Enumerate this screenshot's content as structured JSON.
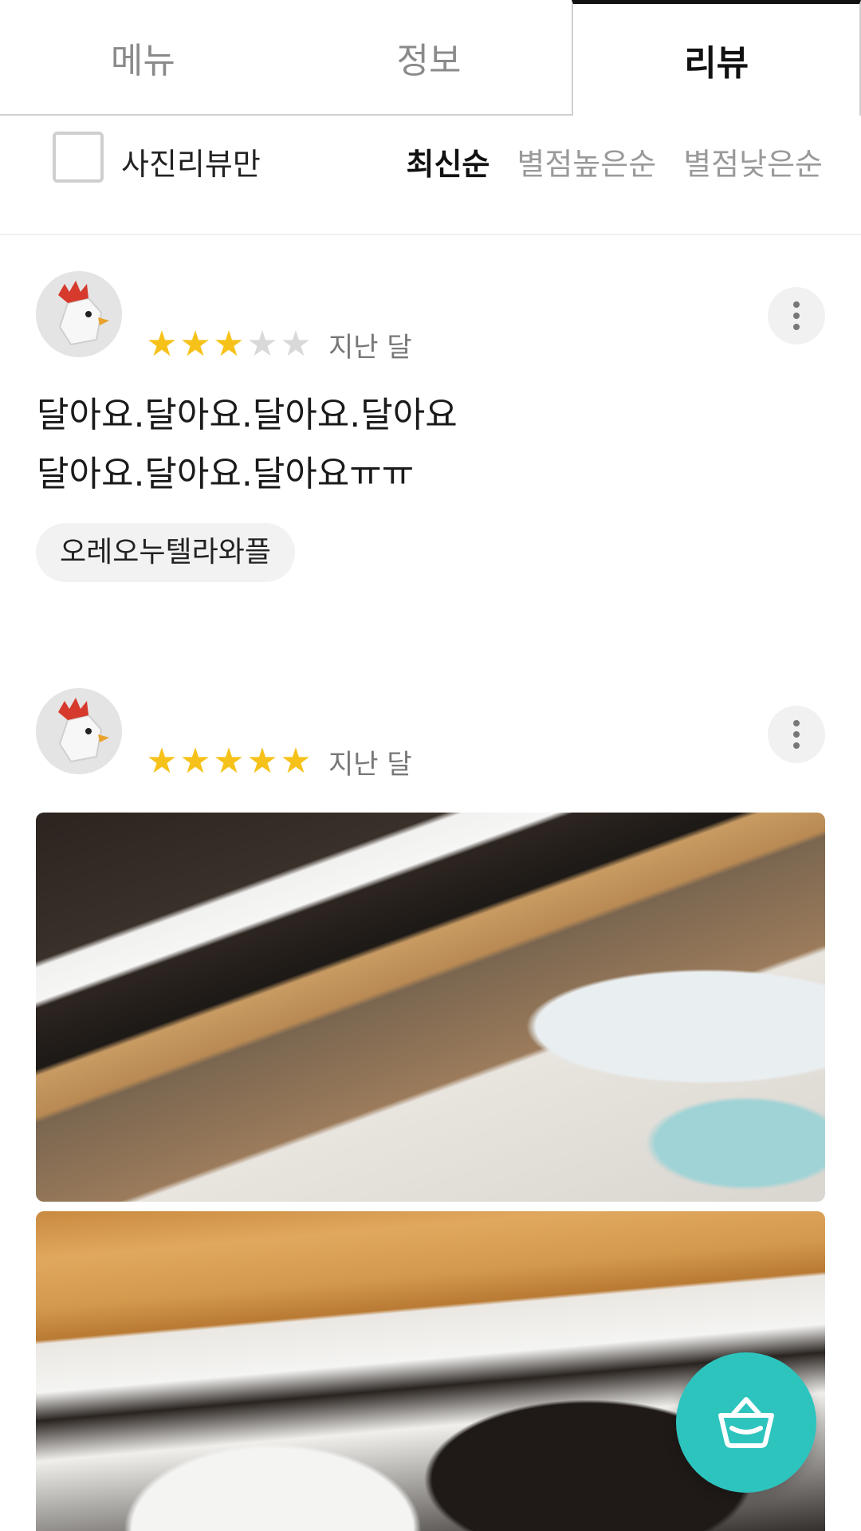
{
  "tabs": [
    {
      "label": "메뉴",
      "active": false
    },
    {
      "label": "정보",
      "active": false
    },
    {
      "label": "리뷰",
      "active": true
    }
  ],
  "filter": {
    "photo_only_label": "사진리뷰만",
    "photo_only_checked": false,
    "sort_options": [
      {
        "label": "최신순",
        "active": true
      },
      {
        "label": "별점높은순",
        "active": false
      },
      {
        "label": "별점낮은순",
        "active": false
      }
    ]
  },
  "reviews": [
    {
      "avatar_icon": "chicken-avatar-icon",
      "rating": 3,
      "max_rating": 5,
      "date": "지난 달",
      "text_lines": [
        "달아요.달아요.달아요.달아요",
        "달아요.달아요.달아요ㅠㅠ"
      ],
      "menu_tag": "오레오누텔라와플"
    },
    {
      "avatar_icon": "chicken-avatar-icon",
      "rating": 5,
      "max_rating": 5,
      "date": "지난 달",
      "photos": [
        "waffle-photo",
        "waffle-photo"
      ]
    }
  ],
  "colors": {
    "star_on": "#f6c21a",
    "star_off": "#d9d9d9",
    "cart_fab": "#2ec4be"
  },
  "cart_icon": "shopping-basket-icon"
}
